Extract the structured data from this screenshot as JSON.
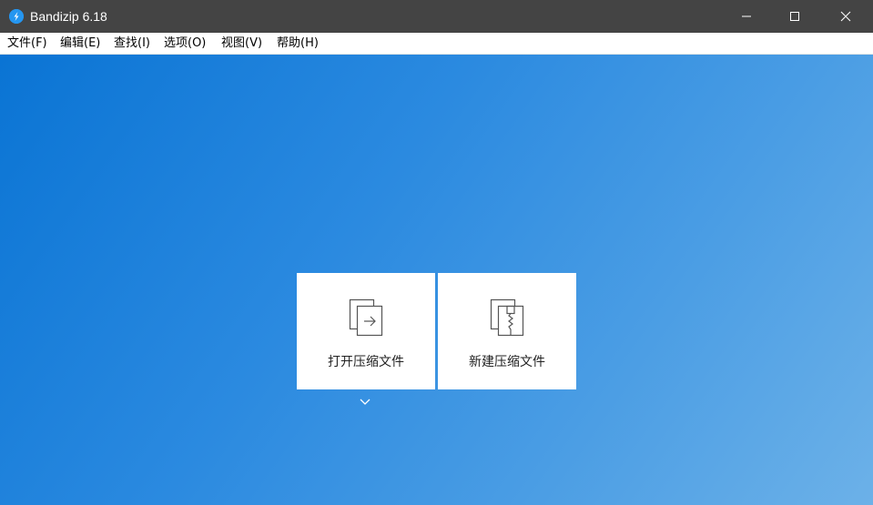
{
  "window": {
    "title": "Bandizip 6.18",
    "icon": "bandizip-logo-icon",
    "controls": [
      "minimize-icon",
      "maximize-icon",
      "close-icon"
    ]
  },
  "menu": [
    {
      "label": "文件(F)"
    },
    {
      "label": "编辑(E)"
    },
    {
      "label": "查找(I)"
    },
    {
      "label": "选项(O)"
    },
    {
      "label": "视图(V)"
    },
    {
      "label": "帮助(H)"
    }
  ],
  "actions": {
    "open_archive": {
      "label": "打开压缩文件",
      "icon": "open-archive-icon"
    },
    "new_archive": {
      "label": "新建压缩文件",
      "icon": "new-archive-icon"
    },
    "more": {
      "icon": "chevron-down-icon"
    }
  },
  "colors": {
    "titlebar": "#444444",
    "background_start": "#0a74d4",
    "background_end": "#6cb1e8",
    "card": "#ffffff"
  }
}
